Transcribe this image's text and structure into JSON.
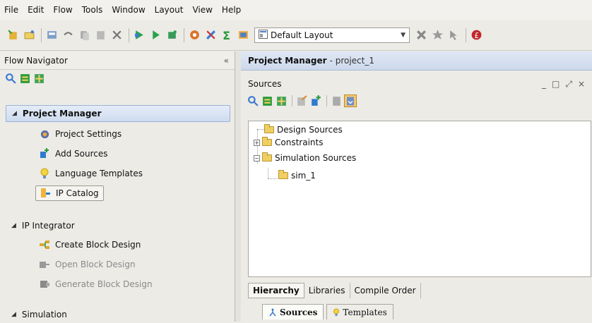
{
  "menu": [
    "File",
    "Edit",
    "Flow",
    "Tools",
    "Window",
    "Layout",
    "View",
    "Help"
  ],
  "toolbar": {
    "layout_select_value": "Default Layout",
    "icons": [
      "new-project-icon",
      "open-project-icon",
      "save-icon",
      "undo-icon",
      "copy-icon",
      "paste-icon",
      "delete-icon",
      "run-icon",
      "run-synthesis-icon",
      "open-hardware-icon",
      "settings-icon",
      "tools-icon",
      "sum-icon",
      "report-icon",
      "layout-icon",
      "chevron-down-icon",
      "pin-icon",
      "star-icon",
      "cursor-icon",
      "help-icon"
    ]
  },
  "flow_navigator": {
    "title": "Flow Navigator",
    "collapse": "«",
    "sections": [
      {
        "label": "Project Manager",
        "items": [
          {
            "label": "Project Settings",
            "icon": "gear-icon",
            "enabled": true
          },
          {
            "label": "Add Sources",
            "icon": "add-sources-icon",
            "enabled": true
          },
          {
            "label": "Language Templates",
            "icon": "lightbulb-icon",
            "enabled": true
          },
          {
            "label": "IP Catalog",
            "icon": "ip-catalog-icon",
            "enabled": true,
            "selected": true
          }
        ]
      },
      {
        "label": "IP Integrator",
        "items": [
          {
            "label": "Create Block Design",
            "icon": "create-block-design-icon",
            "enabled": true
          },
          {
            "label": "Open Block Design",
            "icon": "open-block-design-icon",
            "enabled": false
          },
          {
            "label": "Generate Block Design",
            "icon": "generate-block-design-icon",
            "enabled": false
          }
        ]
      },
      {
        "label": "Simulation",
        "items": []
      }
    ]
  },
  "project_manager": {
    "title": "Project Manager",
    "project": "- project_1"
  },
  "sources": {
    "title": "Sources",
    "window_controls": [
      "_",
      "□",
      "⤢",
      "×"
    ],
    "tree": [
      {
        "label": "Design Sources"
      },
      {
        "label": "Constraints"
      },
      {
        "label": "Simulation Sources"
      },
      {
        "label": "sim_1"
      }
    ],
    "view_tabs": [
      "Hierarchy",
      "Libraries",
      "Compile Order"
    ],
    "panel_tabs": [
      "Sources",
      "Templates"
    ]
  }
}
